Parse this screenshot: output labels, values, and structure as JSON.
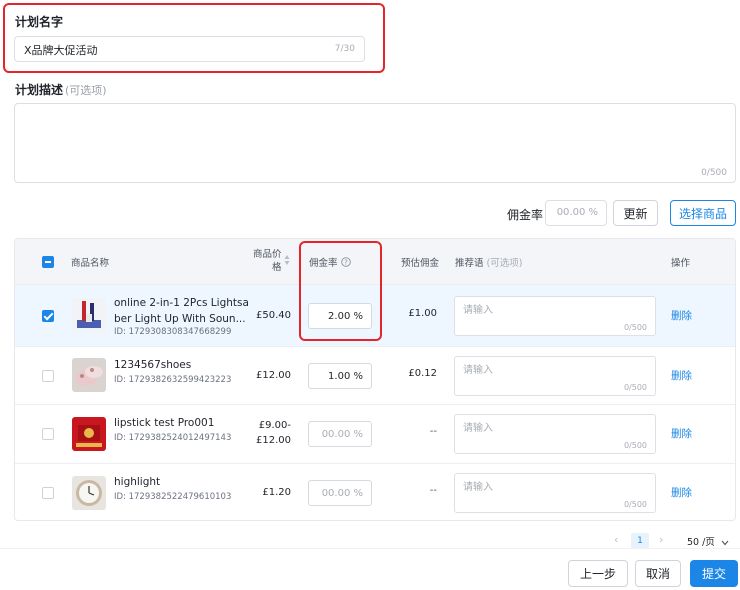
{
  "plan_name": {
    "label": "计划名字",
    "value": "X品牌大促活动",
    "counter": "7/30"
  },
  "plan_desc": {
    "label": "计划描述",
    "optional": "(可选项)",
    "value": "",
    "counter": "0/500"
  },
  "commission_controls": {
    "label": "佣金率",
    "placeholder": "00.00 %",
    "update_button": "更新",
    "select_products_button": "选择商品"
  },
  "table": {
    "headers": {
      "product_name": "商品名称",
      "price_line1": "商品价",
      "price_line2": "格",
      "commission_rate": "佣金率",
      "est_commission": "预估佣金",
      "recommendation": "推荐语",
      "recommendation_optional": "(可选项)",
      "actions": "操作"
    },
    "rows": [
      {
        "selected": true,
        "name_line1": "online 2-in-1 2Pcs Lightsa",
        "name_line2": "ber Light Up With Soun...",
        "id": "ID: 1729308308347668299",
        "price_line1": "£50.40",
        "price_line2": "",
        "rate": "2.00 %",
        "est": "£1.00",
        "rec_placeholder": "请输入",
        "rec_counter": "0/500",
        "action": "删除"
      },
      {
        "selected": false,
        "name_line1": "1234567shoes",
        "name_line2": "",
        "id": "ID: 1729382632599423223",
        "price_line1": "£12.00",
        "price_line2": "",
        "rate": "1.00 %",
        "est": "£0.12",
        "rec_placeholder": "请输入",
        "rec_counter": "0/500",
        "action": "删除"
      },
      {
        "selected": false,
        "name_line1": "lipstick test Pro001",
        "name_line2": "",
        "id": "ID: 1729382524012497143",
        "price_line1": "£9.00-",
        "price_line2": "£12.00",
        "rate": "00.00 %",
        "est": "--",
        "rec_placeholder": "请输入",
        "rec_counter": "0/500",
        "action": "删除"
      },
      {
        "selected": false,
        "name_line1": "highlight",
        "name_line2": "",
        "id": "ID: 1729382522479610103",
        "price_line1": "£1.20",
        "price_line2": "",
        "rate": "00.00 %",
        "est": "--",
        "rec_placeholder": "请输入",
        "rec_counter": "0/500",
        "action": "删除"
      }
    ]
  },
  "pagination": {
    "current_page": "1",
    "page_size": "50 /页"
  },
  "footer": {
    "prev_button": "上一步",
    "cancel_button": "取消",
    "submit_button": "提交"
  },
  "colors": {
    "accent": "#1b86e6",
    "highlight": "#e5252a",
    "selected_row": "#eef6ff"
  }
}
